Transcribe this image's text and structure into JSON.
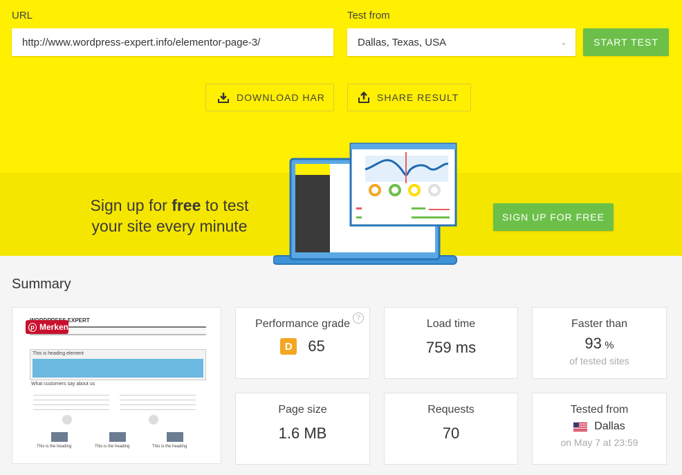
{
  "form": {
    "url_label": "URL",
    "url_value": "http://www.wordpress-expert.info/elementor-page-3/",
    "test_from_label": "Test from",
    "test_from_value": "Dallas, Texas, USA",
    "start_test": "START TEST"
  },
  "actions": {
    "download_har": "DOWNLOAD HAR",
    "share_result": "SHARE RESULT"
  },
  "promo": {
    "line1_pre": "Sign up for ",
    "line1_bold": "free",
    "line1_post": " to test",
    "line2": "your site every minute",
    "signup_button": "SIGN UP FOR FREE"
  },
  "summary": {
    "title": "Summary",
    "screenshot": {
      "pin_button": "Merken",
      "site_title": "WORDPRESS EXPERT",
      "heading": "This is heading element",
      "customers": "What customers say about us",
      "card_heading": "This is the heading"
    },
    "performance_grade": {
      "label": "Performance grade",
      "grade": "D",
      "score": "65"
    },
    "load_time": {
      "label": "Load time",
      "value": "759 ms"
    },
    "faster_than": {
      "label": "Faster than",
      "value": "93",
      "unit": "%",
      "sub": "of tested sites"
    },
    "page_size": {
      "label": "Page size",
      "value": "1.6 MB"
    },
    "requests": {
      "label": "Requests",
      "value": "70"
    },
    "tested_from": {
      "label": "Tested from",
      "city": "Dallas",
      "date": "on May 7 at 23:59"
    }
  },
  "colors": {
    "yellow": "#ffef00",
    "green": "#6cc04a",
    "grade_d": "#f5a623"
  }
}
